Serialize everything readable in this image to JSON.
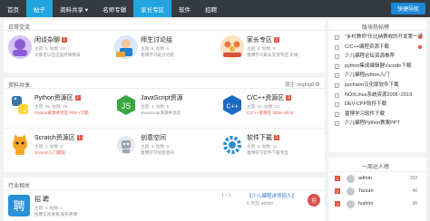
{
  "nav": {
    "items": [
      {
        "label": "首页"
      },
      {
        "label": "帖子"
      },
      {
        "label": "资料共享 ▾"
      },
      {
        "label": "名师专辑"
      },
      {
        "label": "家长专区"
      },
      {
        "label": "软件"
      },
      {
        "label": "招聘"
      }
    ],
    "search_button": "快捷导航"
  },
  "daily": {
    "title": "日常交流",
    "forums": [
      {
        "name": "闲谈杂聊",
        "badge": "1",
        "meta": "主题: 5, 帖数: 10",
        "desc": "大家可以在这里尽情畅谈",
        "color": "#b27be0"
      },
      {
        "name": "师生讨论组",
        "meta": "主题: 6, 帖数: 6",
        "desc": "塞博学习班讨论组",
        "color": "#1f7dd1"
      },
      {
        "name": "家长专区",
        "badge": "1",
        "meta": "主题: 8, 帖数: 9",
        "desc": "塞博学习家长交流专区 实体,",
        "color": "#f0a54a"
      }
    ]
  },
  "share": {
    "title": "资料共享",
    "moderator": "版主: bigbig8",
    "forums": [
      {
        "name": "Python资源区",
        "badge": "1",
        "meta": "主题: 25, 帖数: 25",
        "desc": "Python资源共享区,PDF+习题",
        "red": true,
        "color": "#2f7bbf"
      },
      {
        "name": "JavaScript资源",
        "meta": "主题: 4, 帖数: 5",
        "desc": "JavaScript资源共享区",
        "color": "#3aa640"
      },
      {
        "name": "C/C++资源区",
        "badge": "1",
        "meta": "主题: 20, 帖数: 21",
        "desc": "C/C++资源区 2006~2019",
        "red": true,
        "color": "#1e6bc4"
      },
      {
        "name": "Scratch资源区",
        "badge": "1",
        "meta": "主题: 2, 帖数: 2",
        "desc": "Scratch入门教程",
        "red": true,
        "color": "#f6a623"
      },
      {
        "name": "创意空间",
        "meta": "主题: 3, 帖数: 5",
        "desc": "塞博学习创意空间",
        "color": "#9aa4ad"
      },
      {
        "name": "软件下载",
        "badge": "1",
        "meta": "主题: 5, 帖数: 11",
        "desc": "塞博学习软件下载专区",
        "color": "#2a8fd6"
      }
    ]
  },
  "jobs": {
    "title": "行业相关",
    "forum": {
      "name": "招 聘",
      "meta": "主题: 1, 帖数: 1",
      "desc": "招聘信息发布,发布者请",
      "color": "#2a8fd6"
    },
    "pager": "1 / 1",
    "latest": "【少儿编程讲师招人】",
    "latest_meta": "6 天前 admin",
    "right_btn": "招"
  },
  "hot": {
    "title": "版块热帖榜",
    "items": [
      {
        "text": "“乡村教师”乐比纳赛收的开发第一课"
      },
      {
        "text": "C/C++编程资源下载"
      },
      {
        "text": "少儿编程论坛资源推荐"
      },
      {
        "text": "python集成编辑器Vscode下载"
      },
      {
        "text": "少儿编程python入门"
      },
      {
        "text": "pycharm汉化版软件下载"
      },
      {
        "text": "NOI/Linux系统资源2006~2019"
      },
      {
        "text": "DEV-CPP软件下载"
      },
      {
        "text": "塞博学习软件下载"
      },
      {
        "text": "少儿编程Python教案PPT"
      }
    ]
  },
  "rank": {
    "title": "一周达人榜",
    "items": [
      {
        "no": "1",
        "name": "admin",
        "count": "153"
      },
      {
        "no": "2",
        "name": "Tarzan",
        "count": "40"
      },
      {
        "no": "3",
        "name": "fushini",
        "count": "36"
      }
    ]
  }
}
